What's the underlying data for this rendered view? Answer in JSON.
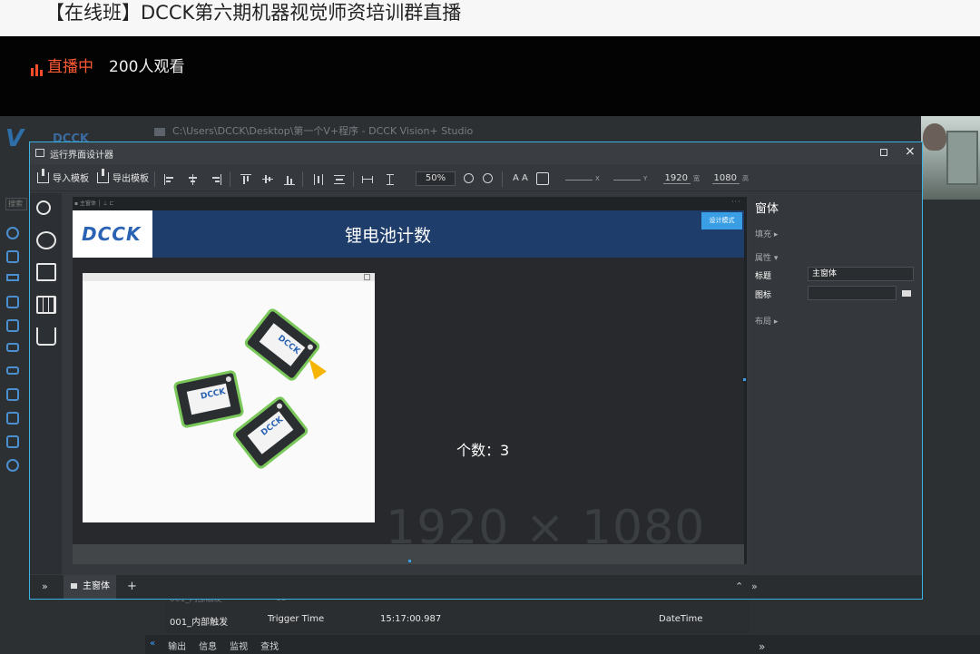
{
  "stream": {
    "title": "【在线班】DCCK第六期机器视觉师资培训群直播",
    "live_label": "直播中",
    "viewers": "200人观看"
  },
  "studio": {
    "window_path": "C:\\Users\\DCCK\\Desktop\\第一个V+程序 - DCCK Vision+ Studio",
    "brand": "DCCK",
    "search_placeholder": "搜索",
    "log_row": {
      "name": "001_内部触发",
      "type": "Trigger Time",
      "value": "15:17:00.987",
      "data_type": "DateTime"
    },
    "bottom_tabs": [
      "输出",
      "信息",
      "监视",
      "查找"
    ]
  },
  "dialog": {
    "title": "运行界面设计器",
    "toolbar": {
      "import_label": "导入模板",
      "export_label": "导出模板",
      "zoom": "50%",
      "font_icon": "A A",
      "x_label": "X",
      "y_label": "Y",
      "width_value": "1920",
      "width_label": "宽",
      "height_value": "1080",
      "height_label": "高"
    },
    "canvas": {
      "logo_text": "DCCK",
      "main_title": "锂电池计数",
      "mode_button": "设计模式",
      "count_text": "个数：3",
      "resolution_watermark": "1920 × 1080",
      "battery_label": "DCCK"
    },
    "properties": {
      "heading": "窗体",
      "fill_group": "填充 ▸",
      "attributes_group": "属性 ▾",
      "title_label": "标题",
      "title_value": "主窗体",
      "icon_label": "图标",
      "layout_group": "布局 ▸"
    },
    "bottom": {
      "tab_label": "主窗体",
      "add": "+"
    }
  }
}
